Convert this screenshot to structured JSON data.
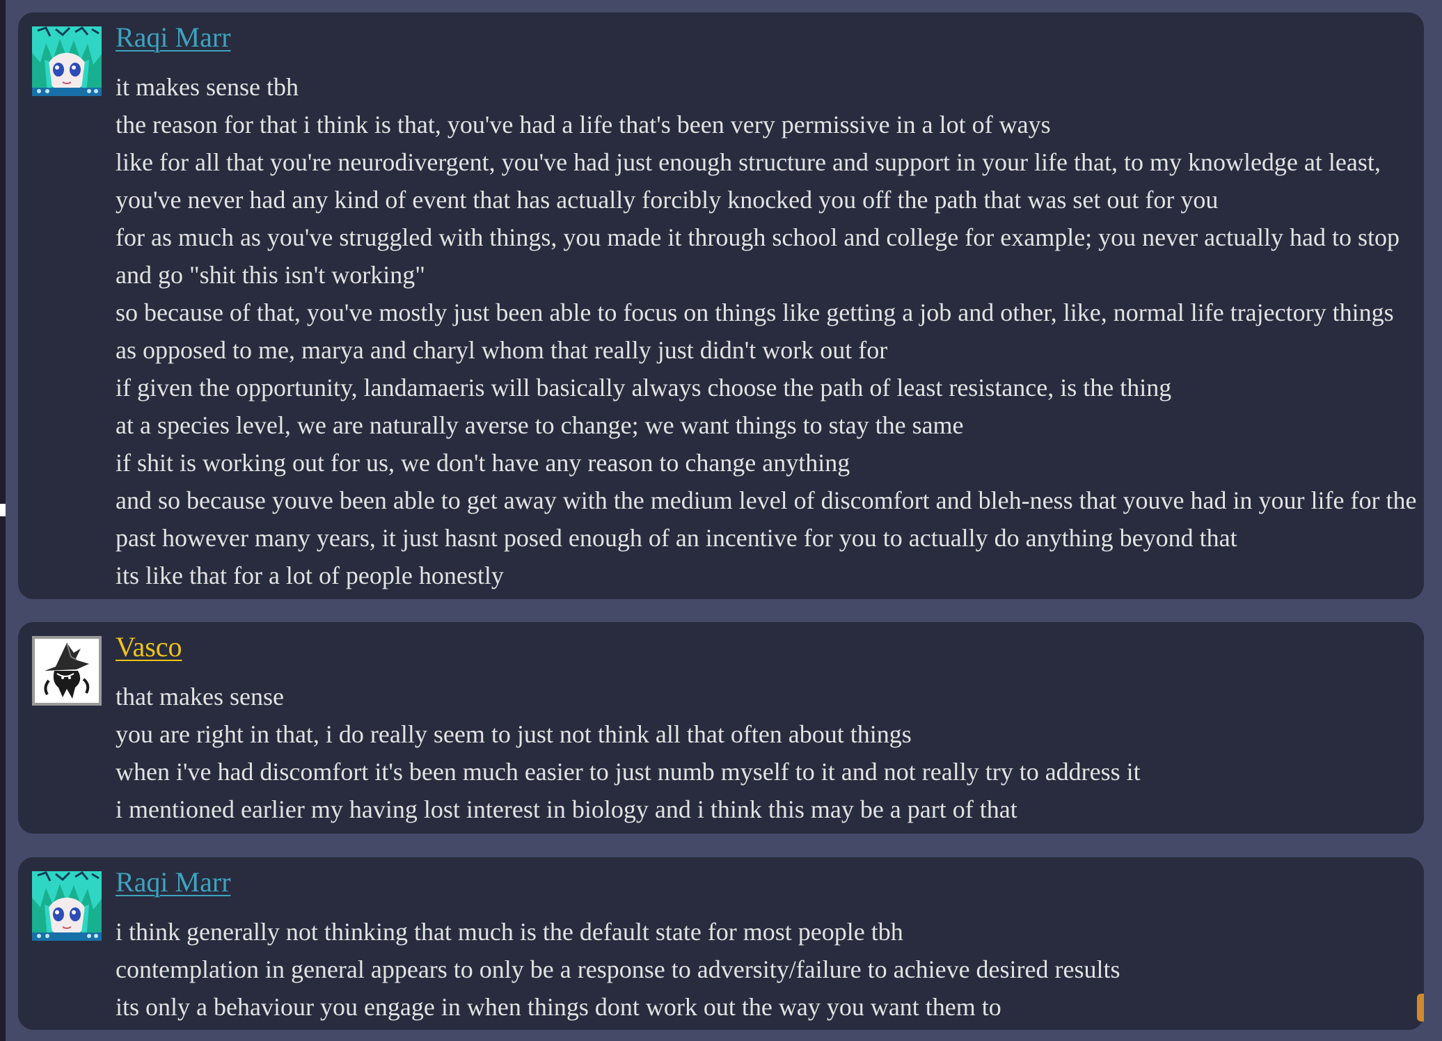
{
  "colors": {
    "page_background": "#444a68",
    "card_background": "#282c3e",
    "text": "#e3e3e3",
    "raqi_name": "#3ea3bf",
    "vasco_name": "#f0c419"
  },
  "messages": [
    {
      "author": "Raqi Marr",
      "avatar_icon": "raqi-anime-avatar-icon",
      "lines": [
        "it makes sense tbh",
        "the reason for that i think is that, you've had a life that's been very permissive in a lot of ways",
        "like for all that you're neurodivergent, you've had just enough structure and support in your life that, to my knowledge at least,",
        "you've never had any kind of event that has actually forcibly knocked you off the path that was set out for you",
        "for as much as you've struggled with things, you made it through school and college for example; you never actually had to stop",
        "and go \"shit this isn't working\"",
        "so because of that, you've mostly just been able to focus on things like getting a job and other, like, normal life trajectory things",
        "as opposed to me, marya and charyl whom that really just didn't work out for",
        "if given the opportunity, landamaeris will basically always choose the path of least resistance, is the thing",
        "at a species level, we are naturally averse to change; we want things to stay the same",
        "if shit is working out for us, we don't have any reason to change anything",
        "and so because youve been able to get away with the medium level of discomfort and bleh-ness that youve had in your life for the",
        "past however many years, it just hasnt posed enough of an incentive for you to actually do anything beyond that",
        "its like that for a lot of people honestly"
      ]
    },
    {
      "author": "Vasco",
      "avatar_icon": "wizard-hat-avatar-icon",
      "lines": [
        "that makes sense",
        "you are right in that, i do really seem to just not think all that often about things",
        "when i've had discomfort it's been much easier to just numb myself to it and not really try to address it",
        "i mentioned earlier my having lost interest in biology and i think this may be a part of that"
      ]
    },
    {
      "author": "Raqi Marr",
      "avatar_icon": "raqi-anime-avatar-icon",
      "lines": [
        "i think generally not thinking that much is the default state for most people tbh",
        "contemplation in general appears to only be a response to adversity/failure to achieve desired results",
        "its only a behaviour you engage in when things dont work out the way you want them to"
      ]
    }
  ]
}
